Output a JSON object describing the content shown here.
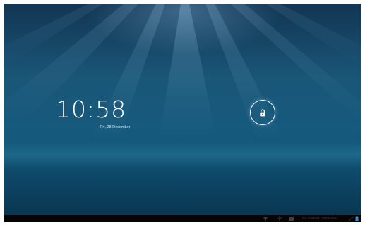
{
  "lockscreen": {
    "time": "10:58",
    "date": "Fri, 28 December"
  },
  "statusbar": {
    "connection_text": "No internet connection",
    "icons": [
      "signal-icon",
      "usb-icon",
      "android-debug-icon",
      "no-signal-icon",
      "battery-icon"
    ]
  },
  "colors": {
    "wallpaper_top": "#123553",
    "wallpaper_mid": "#1a5677",
    "statusbar_bg": "#050505",
    "clock_text": "#ffffff"
  }
}
